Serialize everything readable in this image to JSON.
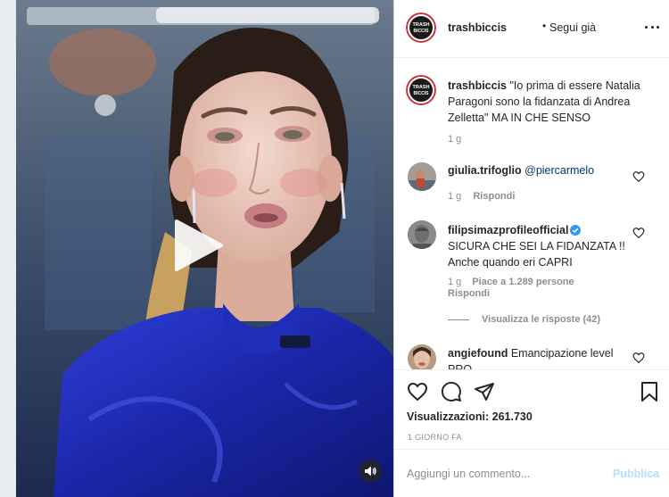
{
  "post": {
    "author": "trashbiccis",
    "avatar_text": [
      "TRASH",
      "BICCIS"
    ],
    "follow_status": "Segui già",
    "caption": "\"Io prima di essere Natalia Paragoni sono la fidanzata di Andrea Zelletta\" MA IN CHE SENSO",
    "caption_time": "1 g"
  },
  "comments": [
    {
      "username": "giulia.trifoglio",
      "text": "@piercarmelo",
      "time": "1 g",
      "reply_label": "Rispondi"
    },
    {
      "username": "filipsimazprofileofficial",
      "verified": true,
      "text": "SICURA CHE SEI LA FIDANZATA !! Anche quando eri CAPRI",
      "time": "1 g",
      "likes": "Piace a 1.289 persone",
      "reply_label": "Rispondi",
      "view_replies": "Visualizza le risposte (42)"
    },
    {
      "username": "angiefound",
      "text": "Emancipazione level PRO"
    }
  ],
  "stats": {
    "views_label": "Visualizzazioni:",
    "views_count": "261.730",
    "date": "1 GIORNO FA"
  },
  "comment_box": {
    "placeholder": "Aggiungi un commento...",
    "publish_label": "Pubblica"
  },
  "colors": {
    "verified_blue": "#3897f0",
    "publish_disabled": "#b2dffc",
    "avatar_ring": "#c9303e"
  },
  "icons": {
    "play": "play-icon",
    "mute": "speaker-icon",
    "more": "more-options-icon",
    "like": "heart-icon",
    "comment": "comment-icon",
    "share": "paper-plane-icon",
    "save": "bookmark-icon"
  }
}
